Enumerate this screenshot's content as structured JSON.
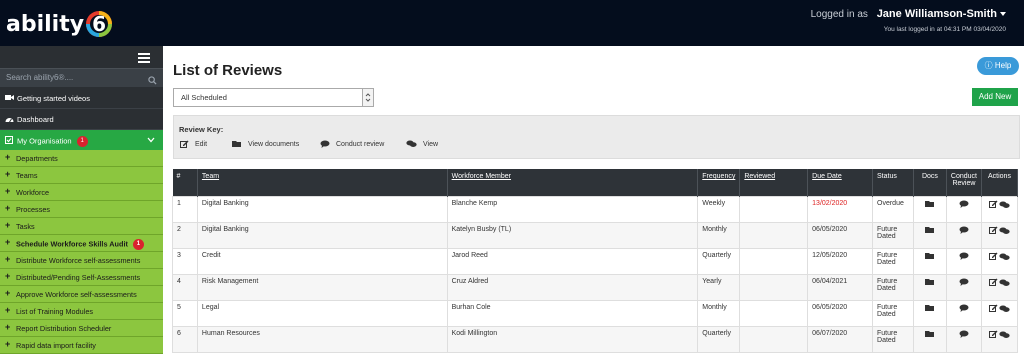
{
  "brand": {
    "logo_text": "ability",
    "logo_number": "6"
  },
  "user": {
    "logged_in_as": "Logged in as",
    "name": "Jane Williamson-Smith",
    "last_login": "You last logged in at 04:31 PM 03/04/2020"
  },
  "sidebar": {
    "search_placeholder": "Search ability6®....",
    "items": [
      {
        "label": "Getting started videos",
        "icon": "video-camera-icon"
      },
      {
        "label": "Dashboard",
        "icon": "dashboard-icon"
      },
      {
        "label": "My Organisation",
        "icon": "checkbox-icon",
        "badge": "1"
      }
    ],
    "subitems": [
      {
        "label": "Departments"
      },
      {
        "label": "Teams"
      },
      {
        "label": "Workforce"
      },
      {
        "label": "Processes"
      },
      {
        "label": "Tasks"
      },
      {
        "label": "Schedule Workforce Skills Audit",
        "badge": "1",
        "bold": true
      },
      {
        "label": "Distribute Workforce self-assessments"
      },
      {
        "label": "Distributed/Pending Self-Assessments"
      },
      {
        "label": "Approve Workforce self-assessments"
      },
      {
        "label": "List of Training Modules"
      },
      {
        "label": "Report Distribution Scheduler"
      },
      {
        "label": "Rapid data import facility"
      }
    ]
  },
  "main": {
    "title": "List of Reviews",
    "help_label": "Help",
    "filter_value": "All Scheduled",
    "add_new_label": "Add New",
    "review_key": {
      "title": "Review Key:",
      "items": [
        {
          "label": "Edit",
          "icon": "edit-icon"
        },
        {
          "label": "View documents",
          "icon": "folder-icon"
        },
        {
          "label": "Conduct review",
          "icon": "comment-icon"
        },
        {
          "label": "View",
          "icon": "comments-icon"
        }
      ]
    },
    "table": {
      "headers": {
        "num": "#",
        "team": "Team",
        "member": "Workforce Member",
        "frequency": "Frequency",
        "reviewed": "Reviewed",
        "due": "Due Date",
        "status": "Status",
        "docs": "Docs",
        "conduct": "Conduct Review",
        "actions": "Actions"
      },
      "rows": [
        {
          "num": "1",
          "team": "Digital Banking",
          "member": "Blanche Kemp",
          "frequency": "Weekly",
          "reviewed": "",
          "due": "13/02/2020",
          "status": "Overdue",
          "overdue": true
        },
        {
          "num": "2",
          "team": "Digital Banking",
          "member": "Katelyn Busby (TL)",
          "frequency": "Monthly",
          "reviewed": "",
          "due": "06/05/2020",
          "status": "Future Dated",
          "overdue": false
        },
        {
          "num": "3",
          "team": "Credit",
          "member": "Jarod Reed",
          "frequency": "Quarterly",
          "reviewed": "",
          "due": "12/05/2020",
          "status": "Future Dated",
          "overdue": false
        },
        {
          "num": "4",
          "team": "Risk Management",
          "member": "Cruz Aldred",
          "frequency": "Yearly",
          "reviewed": "",
          "due": "06/04/2021",
          "status": "Future Dated",
          "overdue": false
        },
        {
          "num": "5",
          "team": "Legal",
          "member": "Burhan Cole",
          "frequency": "Monthly",
          "reviewed": "",
          "due": "06/05/2020",
          "status": "Future Dated",
          "overdue": false
        },
        {
          "num": "6",
          "team": "Human Resources",
          "member": "Kodi Millington",
          "frequency": "Quarterly",
          "reviewed": "",
          "due": "06/07/2020",
          "status": "Future Dated",
          "overdue": false
        }
      ]
    }
  },
  "colors": {
    "topbar": "#040d1d",
    "sidebar": "#2b2f33",
    "active_green": "#27a844",
    "submenu_green": "#8cc63f",
    "help_blue": "#3a9ad9",
    "add_green": "#1fa34a",
    "overdue_red": "#d22222",
    "badge_red": "#d9232e"
  }
}
